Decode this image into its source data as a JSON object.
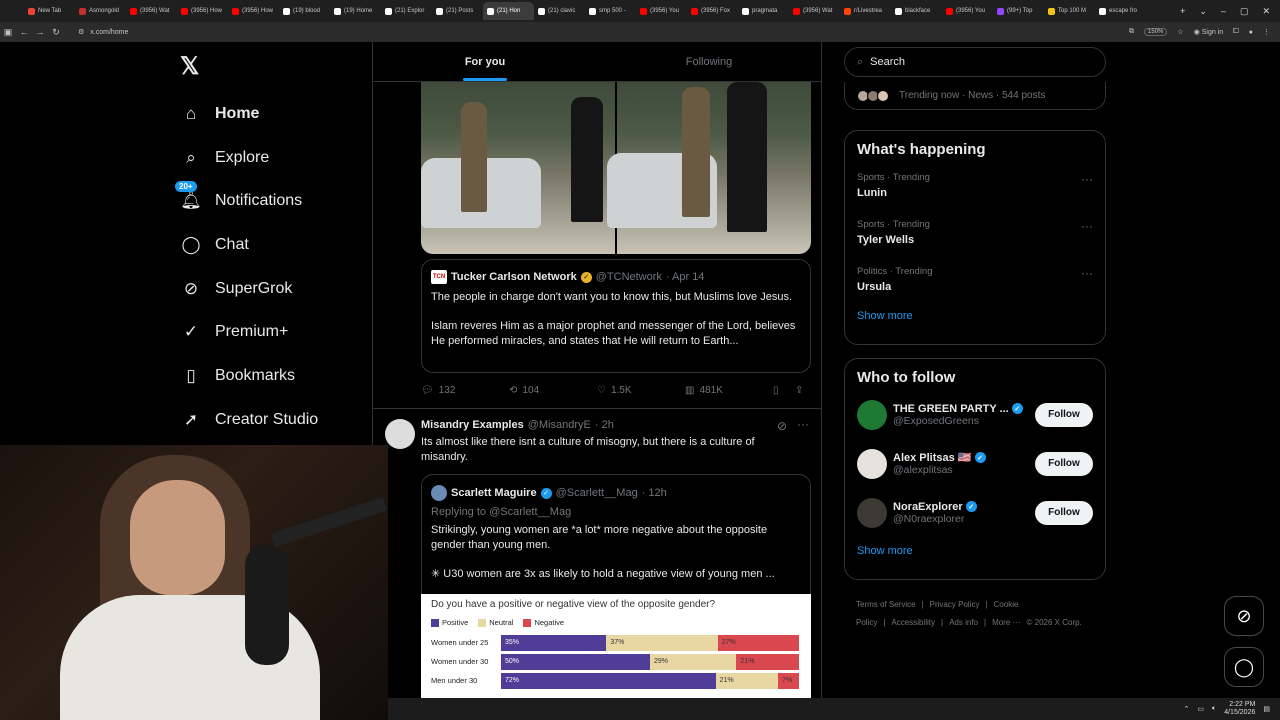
{
  "browser": {
    "tabs": [
      {
        "label": "New Tab",
        "color": "#ea4335"
      },
      {
        "label": "Asmongold",
        "color": "#c4302b"
      },
      {
        "label": "(3956) Wat",
        "color": "#ff0000"
      },
      {
        "label": "(3956) How",
        "color": "#ff0000"
      },
      {
        "label": "(3956) How",
        "color": "#ff0000"
      },
      {
        "label": "(19) blood",
        "color": "#ffffff"
      },
      {
        "label": "(19) Home",
        "color": "#ffffff"
      },
      {
        "label": "(21) Explor",
        "color": "#ffffff"
      },
      {
        "label": "(21) Posts",
        "color": "#ffffff"
      },
      {
        "label": "(21) Hon",
        "color": "#ffffff",
        "active": true
      },
      {
        "label": "(21) clavic",
        "color": "#ffffff"
      },
      {
        "label": "smp 500 -",
        "color": "#ffffff"
      },
      {
        "label": "(3956) You",
        "color": "#ff0000"
      },
      {
        "label": "(3956) Fox",
        "color": "#ff0000"
      },
      {
        "label": "pragmata",
        "color": "#ffffff"
      },
      {
        "label": "(3956) Wat",
        "color": "#ff0000"
      },
      {
        "label": "r/Livestrea",
        "color": "#ff4500"
      },
      {
        "label": "blackface",
        "color": "#ffffff"
      },
      {
        "label": "(3956) You",
        "color": "#ff0000"
      },
      {
        "label": "(99+) Top",
        "color": "#9146ff"
      },
      {
        "label": "Top 100 M",
        "color": "#f5c518"
      },
      {
        "label": "escape fro",
        "color": "#ffffff"
      }
    ],
    "url": "x.com/home",
    "zoom": "150%",
    "sign_in": "Sign in"
  },
  "nav": {
    "items": [
      {
        "label": "Home",
        "icon": "home-icon",
        "glyph": "⌂"
      },
      {
        "label": "Explore",
        "icon": "search-icon",
        "glyph": "⌕"
      },
      {
        "label": "Notifications",
        "icon": "bell-icon",
        "glyph": "🔔︎"
      },
      {
        "label": "Chat",
        "icon": "chat-icon",
        "glyph": "◯"
      },
      {
        "label": "SuperGrok",
        "icon": "grok-icon",
        "glyph": "⊘"
      },
      {
        "label": "Premium+",
        "icon": "premium-icon",
        "glyph": "✓"
      },
      {
        "label": "Bookmarks",
        "icon": "bookmark-icon",
        "glyph": "▯"
      },
      {
        "label": "Creator Studio",
        "icon": "rocket-icon",
        "glyph": "➚"
      }
    ],
    "notif_badge": "20+"
  },
  "feed": {
    "tabs": [
      "For you",
      "Following"
    ],
    "post1": {
      "quote_name": "Tucker Carlson Network",
      "quote_handle": "@TCNetwork",
      "quote_date": "· Apr 14",
      "quote_text1": "The people in charge don't want you to know this, but Muslims love Jesus.",
      "quote_text2": "Islam reveres Him as a major prophet and messenger of the Lord, believes He performed miracles, and states that He will return to Earth...",
      "replies": "132",
      "reposts": "104",
      "likes": "1.5K",
      "views": "481K"
    },
    "post2": {
      "name": "Misandry Examples",
      "handle": "@MisandryE",
      "time": "· 2h",
      "text": "Its almost like there isnt a culture of misogny, but there is a culture of misandry.",
      "quote_name": "Scarlett Maguire",
      "quote_handle": "@Scarlett__Mag",
      "quote_time": "· 12h",
      "replying": "Replying to @Scarlett__Mag",
      "quote_text1": "Strikingly, young women are *a lot* more negative about the opposite gender than young men.",
      "quote_text2": "✳ U30 women are 3x as likely to hold a negative view of young men ..."
    }
  },
  "chart_data": {
    "type": "bar",
    "title": "Do you have a positive or negative view of the opposite gender?",
    "categories": [
      "Women under 25",
      "Women under 30",
      "Men under 30"
    ],
    "series": [
      {
        "name": "Positive",
        "color": "#4f3d97",
        "values": [
          35,
          50,
          72
        ]
      },
      {
        "name": "Neutral",
        "color": "#e9d7a3",
        "values": [
          37,
          29,
          21
        ]
      },
      {
        "name": "Negative",
        "color": "#d9474f",
        "values": [
          27,
          21,
          7
        ]
      }
    ],
    "labels": [
      [
        "35%",
        "37%",
        "27%"
      ],
      [
        "50%",
        "29%",
        "21%"
      ],
      [
        "72%",
        "21%",
        "7%"
      ]
    ]
  },
  "sidebar": {
    "search_placeholder": "Search",
    "trending_now": "Trending now · News · 544 posts",
    "whats_happening": "What's happening",
    "trends": [
      {
        "meta": "Sports · Trending",
        "name": "Lunin"
      },
      {
        "meta": "Sports · Trending",
        "name": "Tyler Wells"
      },
      {
        "meta": "Politics · Trending",
        "name": "Ursula"
      }
    ],
    "show_more": "Show more",
    "who_to_follow": "Who to follow",
    "follow_label": "Follow",
    "suggestions": [
      {
        "name": "THE GREEN PARTY ...",
        "handle": "@ExposedGreens",
        "color": "#1e7a33"
      },
      {
        "name": "Alex Plitsas 🇺🇸",
        "handle": "@alexplitsas",
        "color": "#e7e2dc"
      },
      {
        "name": "NoraExplorer",
        "handle": "@N0raexplorer",
        "color": "#3d3a34"
      }
    ],
    "footer": [
      "Terms of Service",
      "|",
      "Privacy Policy",
      "|",
      "Cookie Policy",
      "|",
      "Accessibility",
      "|",
      "Ads info",
      "|",
      "More ···",
      "© 2026 X Corp."
    ]
  },
  "taskbar": {
    "time": "2:22 PM",
    "date": "4/15/2026"
  }
}
